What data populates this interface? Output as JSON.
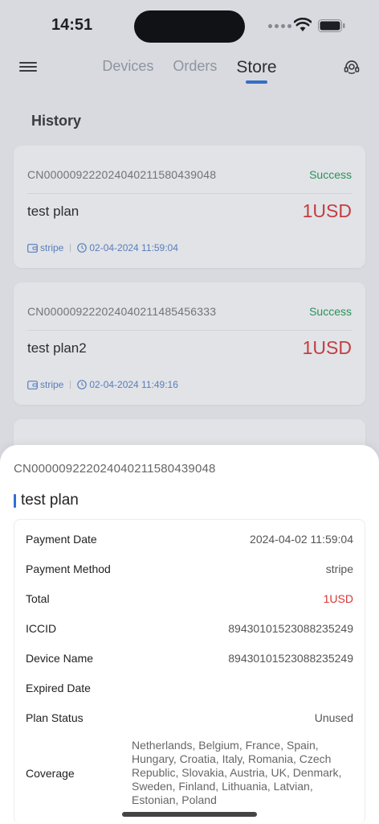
{
  "status_bar": {
    "time": "14:51"
  },
  "nav": {
    "tabs": [
      {
        "label": "Devices",
        "active": false
      },
      {
        "label": "Orders",
        "active": false
      },
      {
        "label": "Store",
        "active": true
      }
    ],
    "menu_icon": "hamburger-menu-icon",
    "support_icon": "customer-support-icon"
  },
  "history": {
    "title": "History",
    "orders": [
      {
        "order_no": "CN00000922202404021158043904​8",
        "status": "Success",
        "plan": "test plan",
        "price": "1USD",
        "method": "stripe",
        "time": "02-04-2024 11:59:04"
      },
      {
        "order_no": "CN000009222024040211485456333",
        "status": "Success",
        "plan": "test plan2",
        "price": "1USD",
        "method": "stripe",
        "time": "02-04-2024 11:49:16"
      }
    ]
  },
  "sheet": {
    "order_no": "CN000009222024040211580439048",
    "plan": "test plan",
    "rows": [
      {
        "label": "Payment Date",
        "value": "2024-04-02 11:59:04"
      },
      {
        "label": "Payment Method",
        "value": "stripe"
      },
      {
        "label": "Total",
        "value": "1USD"
      },
      {
        "label": "ICCID",
        "value": "89430101523088235249"
      },
      {
        "label": "Device Name",
        "value": "89430101523088235249"
      },
      {
        "label": "Expired Date",
        "value": ""
      },
      {
        "label": "Plan Status",
        "value": "Unused"
      }
    ],
    "coverage": {
      "label": "Coverage",
      "value": "Netherlands, Belgium, France, Spain, Hungary, Croatia, Italy, Romania, Czech Republic, Slovakia, Austria, UK, Denmark, Sweden, Finland, Lithuania, Latvian, Estonian, Poland"
    }
  },
  "colors": {
    "accent": "#2f6fd6",
    "success": "#1f9d55",
    "price": "#d93636"
  }
}
